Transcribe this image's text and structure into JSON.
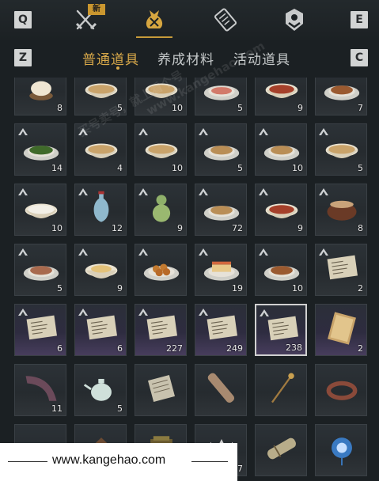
{
  "keys": {
    "q": "Q",
    "e": "E",
    "z": "Z",
    "c": "C"
  },
  "top_tabs": [
    {
      "icon": "crossed-swords-icon",
      "badge": "新"
    },
    {
      "icon": "gold-pouch-icon",
      "active": true
    },
    {
      "icon": "scroll-icon"
    },
    {
      "icon": "shield-badge-icon"
    }
  ],
  "sub_tabs": [
    {
      "label": "普通道具",
      "active": true
    },
    {
      "label": "养成材料"
    },
    {
      "label": "活动道具"
    }
  ],
  "items": [
    {
      "icon": "steamed-bun-icon",
      "count": "8"
    },
    {
      "icon": "noodle-bowl-icon",
      "count": "5"
    },
    {
      "icon": "noodle-bowl-icon",
      "count": "10"
    },
    {
      "icon": "meat-plate-icon",
      "count": "5"
    },
    {
      "icon": "stir-fry-bowl-icon",
      "count": "9"
    },
    {
      "icon": "braised-dish-icon",
      "count": "7"
    },
    {
      "icon": "greens-plate-icon",
      "count": "14",
      "tag": true
    },
    {
      "icon": "soup-bowl-icon",
      "count": "4",
      "tag": true
    },
    {
      "icon": "porridge-bowl-icon",
      "count": "10",
      "tag": true
    },
    {
      "icon": "dumpling-plate-icon",
      "count": "5",
      "tag": true
    },
    {
      "icon": "mixed-plate-icon",
      "count": "10",
      "tag": true
    },
    {
      "icon": "noodle-soup-icon",
      "count": "5",
      "tag": true
    },
    {
      "icon": "rice-bowl-icon",
      "count": "10",
      "tag": true
    },
    {
      "icon": "porcelain-vase-icon",
      "count": "12",
      "tag": true
    },
    {
      "icon": "gourd-flask-icon",
      "count": "9",
      "tag": true
    },
    {
      "icon": "noodle-plate-icon",
      "count": "72",
      "tag": true
    },
    {
      "icon": "chili-dish-icon",
      "count": "9",
      "tag": true
    },
    {
      "icon": "clay-pot-icon",
      "count": "8",
      "tag": true
    },
    {
      "icon": "sliced-meat-icon",
      "count": "5",
      "tag": true
    },
    {
      "icon": "tofu-bowl-icon",
      "count": "9",
      "tag": true
    },
    {
      "icon": "meatball-plate-icon",
      "count": "",
      "tag": true
    },
    {
      "icon": "layer-cake-icon",
      "count": "19",
      "tag": true
    },
    {
      "icon": "roast-meat-icon",
      "count": "10",
      "tag": true
    },
    {
      "icon": "paper-note-icon",
      "count": "2",
      "tag": true
    },
    {
      "icon": "paper-note-icon",
      "count": "6",
      "tag": true,
      "purple": true
    },
    {
      "icon": "paper-note-icon",
      "count": "6",
      "tag": true,
      "purple": true
    },
    {
      "icon": "paper-note-icon",
      "count": "227",
      "tag": true,
      "purple": true
    },
    {
      "icon": "paper-note-icon",
      "count": "249",
      "tag": true,
      "purple": true
    },
    {
      "icon": "paper-note-icon",
      "count": "238",
      "tag": true,
      "purple": true,
      "selected": true
    },
    {
      "icon": "tablet-icon",
      "count": "2",
      "purple": true
    },
    {
      "icon": "horn-icon",
      "count": "11"
    },
    {
      "icon": "teapot-icon",
      "count": "5"
    },
    {
      "icon": "book-icon",
      "count": ""
    },
    {
      "icon": "scroll-rod-icon",
      "count": ""
    },
    {
      "icon": "hairpin-icon",
      "count": ""
    },
    {
      "icon": "bracelet-icon",
      "count": ""
    },
    {
      "icon": "food-plate-icon",
      "count": ""
    },
    {
      "icon": "box-lid-icon",
      "count": ""
    },
    {
      "icon": "bronze-block-icon",
      "count": ""
    },
    {
      "icon": "crown-item-icon",
      "count": "7"
    },
    {
      "icon": "bundle-icon",
      "count": ""
    },
    {
      "icon": "blue-charm-icon",
      "count": ""
    }
  ],
  "watermark": "www.kangehao.com",
  "watermark_label": "买号卖号，就上看个号",
  "footer_url": "www.kangehao.com"
}
